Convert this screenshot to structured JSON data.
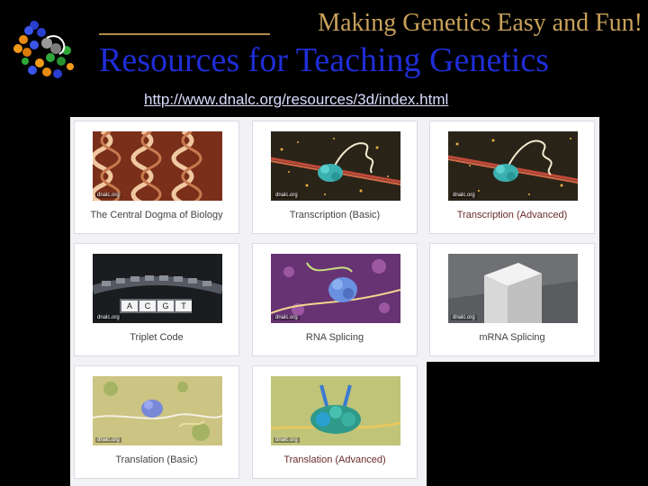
{
  "header": {
    "tagline": "Making Genetics Easy and Fun!",
    "title": "Resources for Teaching Genetics",
    "url": "http://www.dnalc.org/resources/3d/index.html",
    "logo_icon": "dna-molecule-logo-icon"
  },
  "colors": {
    "background": "#000000",
    "title": "#1f2dd6",
    "tagline": "#c9a15a",
    "panel": "#f2f2f5",
    "accent_label": "#6b2a2a"
  },
  "cards": [
    {
      "label": "The Central Dogma of Biology",
      "watermark": "dnalc.org"
    },
    {
      "label": "Transcription (Basic)",
      "watermark": "dnalc.org"
    },
    {
      "label": "Transcription (Advanced)",
      "watermark": "dnalc.org"
    },
    {
      "label": "Triplet Code",
      "watermark": "dnalc.org",
      "codons": [
        "A",
        "C",
        "G",
        "T"
      ]
    },
    {
      "label": "RNA Splicing",
      "watermark": "dnalc.org"
    },
    {
      "label": "mRNA Splicing",
      "watermark": "dnalc.org"
    },
    {
      "label": "Translation (Basic)",
      "watermark": "dnalc.org"
    },
    {
      "label": "Translation (Advanced)",
      "watermark": "dnalc.org"
    }
  ]
}
